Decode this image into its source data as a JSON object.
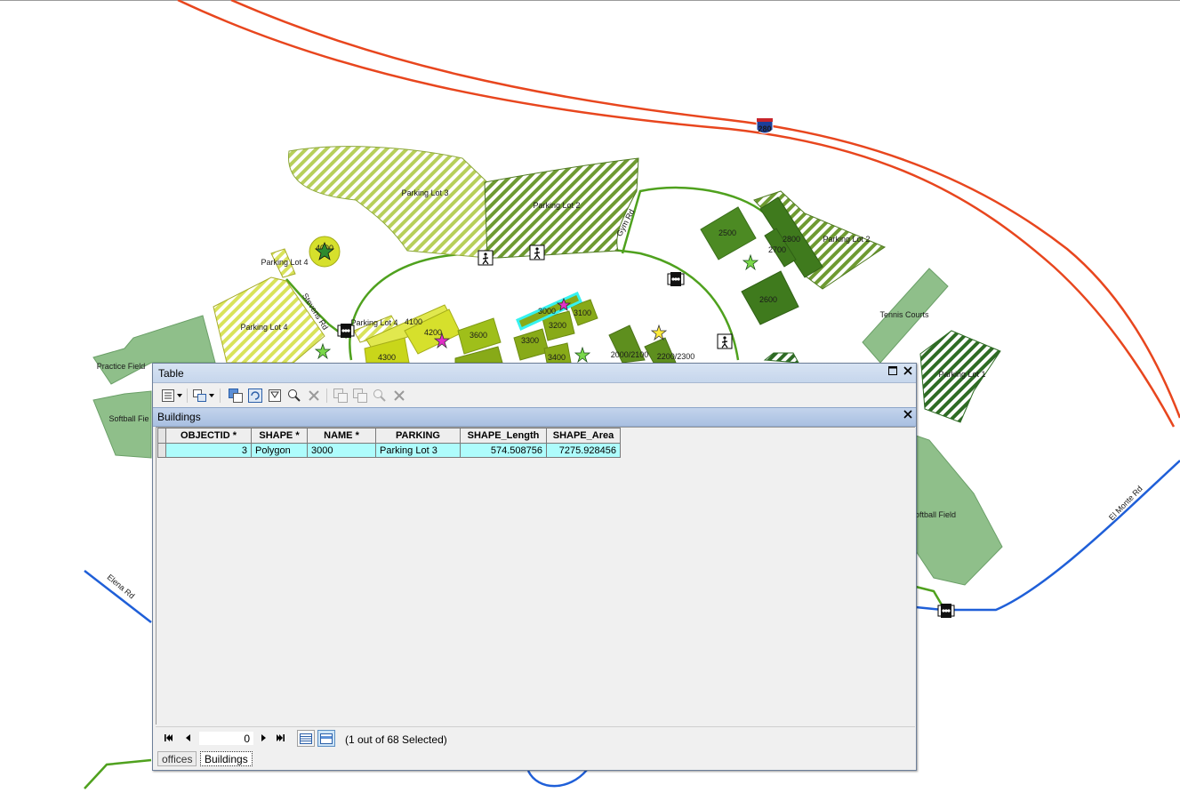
{
  "map": {
    "labels": {
      "parking_lot_3": "Parking Lot 3",
      "parking_lot_2_west": "Parking Lot 2",
      "parking_lot_2_east": "Parking Lot 2",
      "parking_lot_4_north": "Parking Lot 4",
      "parking_lot_4_mid": "Parking Lot 4",
      "parking_lot_4_west": "Parking Lot 4",
      "parking_lot_1": "Parking Lot 1",
      "practice_field": "Practice Field",
      "softball_field_west": "Softball Fie",
      "softball_field_east": "oftball Field",
      "tennis_courts": "Tennis Courts",
      "b2500": "2500",
      "b2800": "2800",
      "b2700": "2700",
      "b2600": "2600",
      "b4000": "4000",
      "b4100": "4100",
      "b4200": "4200",
      "b4300": "4300",
      "b3600": "3600",
      "b3300": "3300",
      "b3200": "3200",
      "b3100": "3100",
      "b3000": "3000",
      "b3400": "3400",
      "b2000_2100": "2000/2100",
      "b2200_2300": "2200/2300",
      "road_gym": "Gym Rd",
      "road_stevens": "Stevens Rd",
      "road_elena": "Elena Rd",
      "road_el_monte": "El Monte Rd",
      "highway_shield": "280"
    }
  },
  "table_window": {
    "title": "Table",
    "subtab_title": "Buildings",
    "columns": [
      "OBJECTID *",
      "SHAPE *",
      "NAME *",
      "PARKING",
      "SHAPE_Length",
      "SHAPE_Area"
    ],
    "rows": [
      [
        "3",
        "Polygon",
        "3000",
        "Parking Lot 3",
        "574.508756",
        "7275.928456"
      ]
    ],
    "record_number": "0",
    "selection_status": "(1 out of 68 Selected)",
    "tabs": [
      "offices",
      "Buildings"
    ]
  }
}
